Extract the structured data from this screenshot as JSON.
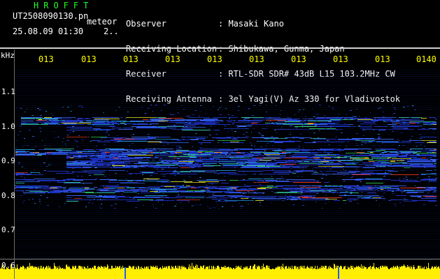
{
  "header": {
    "app_title": "HROFFT",
    "file_name": "UT2508090130.pn",
    "mode": "meteor",
    "datetime": "25.08.09 01:30    2..",
    "info": [
      {
        "label": "Observer",
        "value": ": Masaki Kano"
      },
      {
        "label": "Receiving Location",
        "value": ": Shibukawa, Gunma, Japan"
      },
      {
        "label": "Receiver",
        "value": ": RTL-SDR SDR# 43dB L15 103.2MHz CW"
      },
      {
        "label": "Receiving Antenna",
        "value": ": 3el Yagi(V) Az 330 for Vladivostok"
      }
    ]
  },
  "y_axis": {
    "unit": "kHz",
    "ticks": [
      "1.1",
      "1.0",
      "0.9",
      "0.8",
      "0.7",
      "0.6"
    ]
  },
  "x_axis": {
    "ticks": [
      "013",
      "013",
      "013",
      "013",
      "013",
      "013",
      "013",
      "013",
      "013",
      "0140"
    ]
  },
  "colors": {
    "background": "#000000",
    "title_green": "#22ff22",
    "tick_yellow": "#ffff00",
    "noise_band_yellow": "#ffee00",
    "spectrum_blue": "#2438d8"
  }
}
